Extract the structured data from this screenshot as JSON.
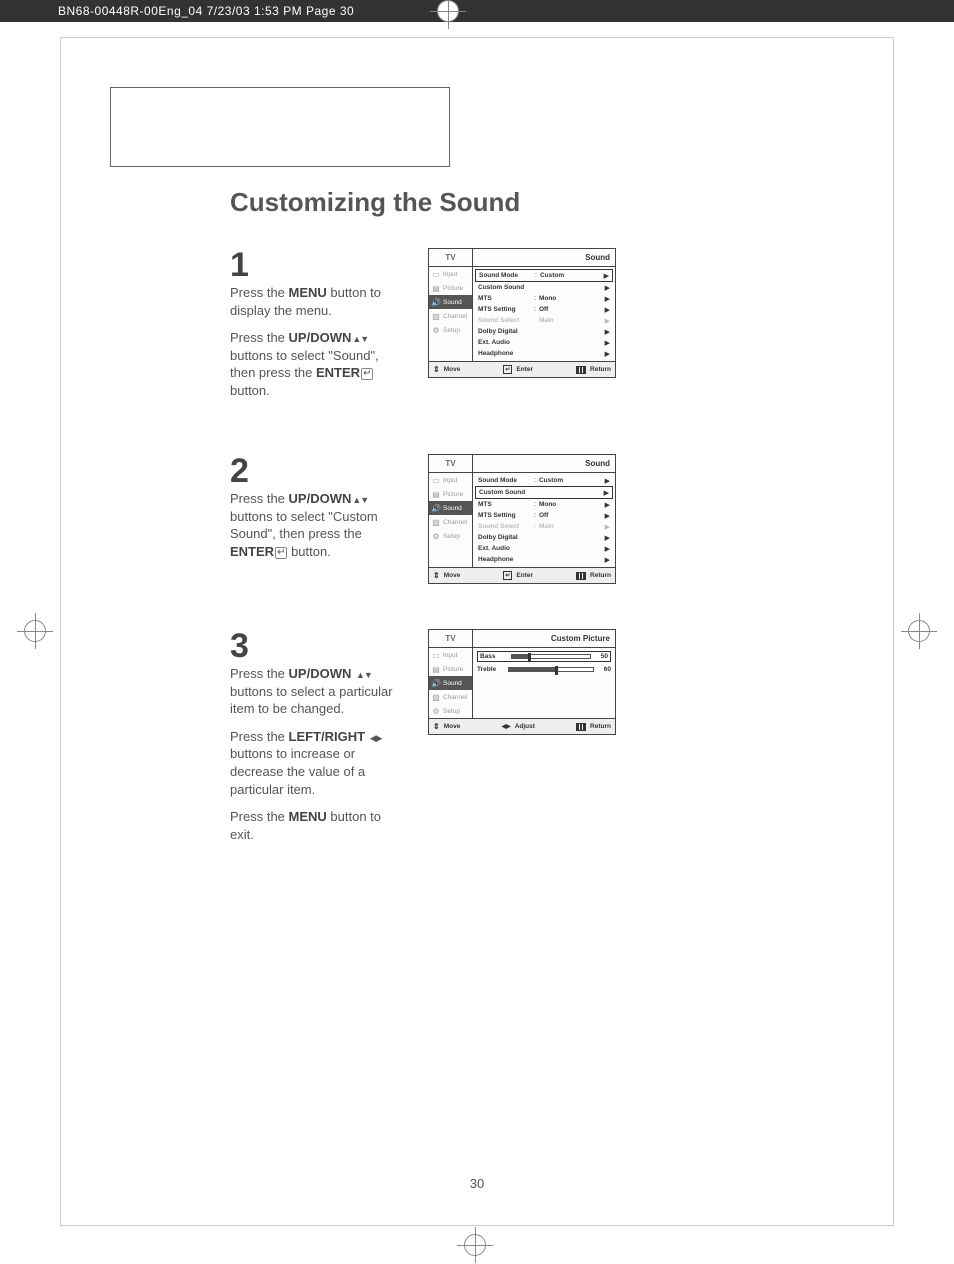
{
  "header": {
    "imprint": "BN68-00448R-00Eng_04  7/23/03 1:53 PM  Page 30"
  },
  "page": {
    "title": "Customizing the Sound",
    "number": "30"
  },
  "steps": {
    "s1": {
      "num": "1",
      "p1a": "Press the ",
      "p1b": "MENU",
      "p1c": " button to display the menu.",
      "p2a": "Press the ",
      "p2b": "UP/DOWN",
      "p2c": " buttons to select \"Sound\", then press the ",
      "p2d": "ENTER",
      "p2e": " button."
    },
    "s2": {
      "num": "2",
      "p1a": "Press the ",
      "p1b": "UP/DOWN",
      "p1c": " buttons to select \"Custom Sound\", then press the ",
      "p1d": "ENTER",
      "p1e": "  button."
    },
    "s3": {
      "num": "3",
      "p1a": "Press the ",
      "p1b": "UP/DOWN",
      "p1c": " buttons to select a particular item to be changed.",
      "p2a": "Press the ",
      "p2b": "LEFT/RIGHT",
      "p2c": " buttons to increase or decrease the value of a particular item.",
      "p3a": "Press the ",
      "p3b": "MENU",
      "p3c": " button to exit."
    }
  },
  "osd_common": {
    "tv": "TV",
    "side": {
      "input": "Input",
      "picture": "Picture",
      "sound": "Sound",
      "channel": "Channel",
      "setup": "Setup"
    },
    "bar": {
      "move": "Move",
      "enter": "Enter",
      "adjust": "Adjust",
      "return": "Return"
    }
  },
  "osd1": {
    "title": "Sound",
    "rows": {
      "sound_mode": {
        "lbl": "Sound Mode",
        "val": "Custom"
      },
      "custom_sound": {
        "lbl": "Custom Sound",
        "val": ""
      },
      "mts": {
        "lbl": "MTS",
        "val": "Mono"
      },
      "mts_setting": {
        "lbl": "MTS Setting",
        "val": "Off"
      },
      "sound_select": {
        "lbl": "Sound Select",
        "val": "Main"
      },
      "dolby": {
        "lbl": "Dolby Digital",
        "val": ""
      },
      "ext_audio": {
        "lbl": "Ext. Audio",
        "val": ""
      },
      "headphone": {
        "lbl": "Headphone",
        "val": ""
      }
    }
  },
  "osd2": {
    "title": "Sound",
    "rows": {
      "sound_mode": {
        "lbl": "Sound Mode",
        "val": "Custom"
      },
      "custom_sound": {
        "lbl": "Custom Sound",
        "val": ""
      },
      "mts": {
        "lbl": "MTS",
        "val": "Mono"
      },
      "mts_setting": {
        "lbl": "MTS Setting",
        "val": "Off"
      },
      "sound_select": {
        "lbl": "Sound Select",
        "val": "Main"
      },
      "dolby": {
        "lbl": "Dolby Digital",
        "val": ""
      },
      "ext_audio": {
        "lbl": "Ext. Audio",
        "val": ""
      },
      "headphone": {
        "lbl": "Headphone",
        "val": ""
      }
    }
  },
  "osd3": {
    "title": "Custom Picture",
    "sliders": {
      "bass": {
        "lbl": "Bass",
        "val": "50"
      },
      "treble": {
        "lbl": "Treble",
        "val": "60"
      }
    }
  }
}
